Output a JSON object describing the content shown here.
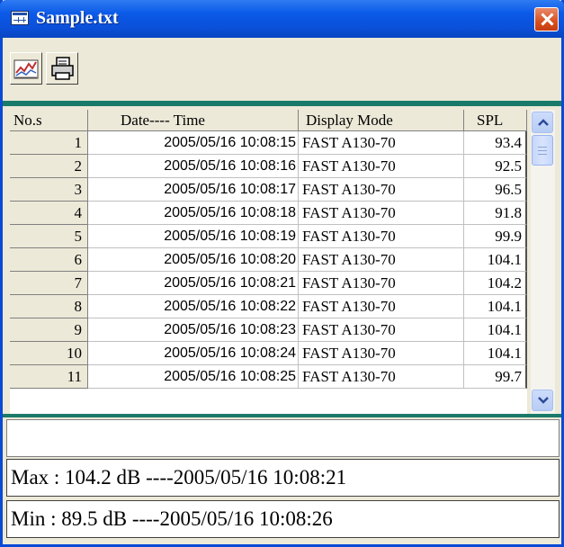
{
  "window": {
    "title": "Sample.txt"
  },
  "toolbar": {
    "buttons": [
      {
        "icon": "chart-icon"
      },
      {
        "icon": "printer-icon"
      }
    ]
  },
  "table": {
    "columns": [
      "No.s",
      "Date---- Time",
      "Display Mode",
      "SPL"
    ],
    "rows": [
      {
        "no": "1",
        "datetime": "2005/05/16 10:08:15",
        "mode": "FAST A130-70",
        "spl": "93.4"
      },
      {
        "no": "2",
        "datetime": "2005/05/16 10:08:16",
        "mode": "FAST A130-70",
        "spl": "92.5"
      },
      {
        "no": "3",
        "datetime": "2005/05/16 10:08:17",
        "mode": "FAST A130-70",
        "spl": "96.5"
      },
      {
        "no": "4",
        "datetime": "2005/05/16 10:08:18",
        "mode": "FAST A130-70",
        "spl": "91.8"
      },
      {
        "no": "5",
        "datetime": "2005/05/16 10:08:19",
        "mode": "FAST A130-70",
        "spl": "99.9"
      },
      {
        "no": "6",
        "datetime": "2005/05/16 10:08:20",
        "mode": "FAST A130-70",
        "spl": "104.1"
      },
      {
        "no": "7",
        "datetime": "2005/05/16 10:08:21",
        "mode": "FAST A130-70",
        "spl": "104.2"
      },
      {
        "no": "8",
        "datetime": "2005/05/16 10:08:22",
        "mode": "FAST A130-70",
        "spl": "104.1"
      },
      {
        "no": "9",
        "datetime": "2005/05/16 10:08:23",
        "mode": "FAST A130-70",
        "spl": "104.1"
      },
      {
        "no": "10",
        "datetime": "2005/05/16 10:08:24",
        "mode": "FAST A130-70",
        "spl": "104.1"
      },
      {
        "no": "11",
        "datetime": "2005/05/16 10:08:25",
        "mode": "FAST A130-70",
        "spl": "99.7"
      }
    ]
  },
  "stats": {
    "max": "Max : 104.2 dB ----2005/05/16 10:08:21",
    "min": "Min : 89.5 dB ----2005/05/16 10:08:26"
  },
  "colors": {
    "titlebar": "#0a4fd8",
    "accent_bar": "#1a7a6a",
    "close": "#d8501e"
  }
}
